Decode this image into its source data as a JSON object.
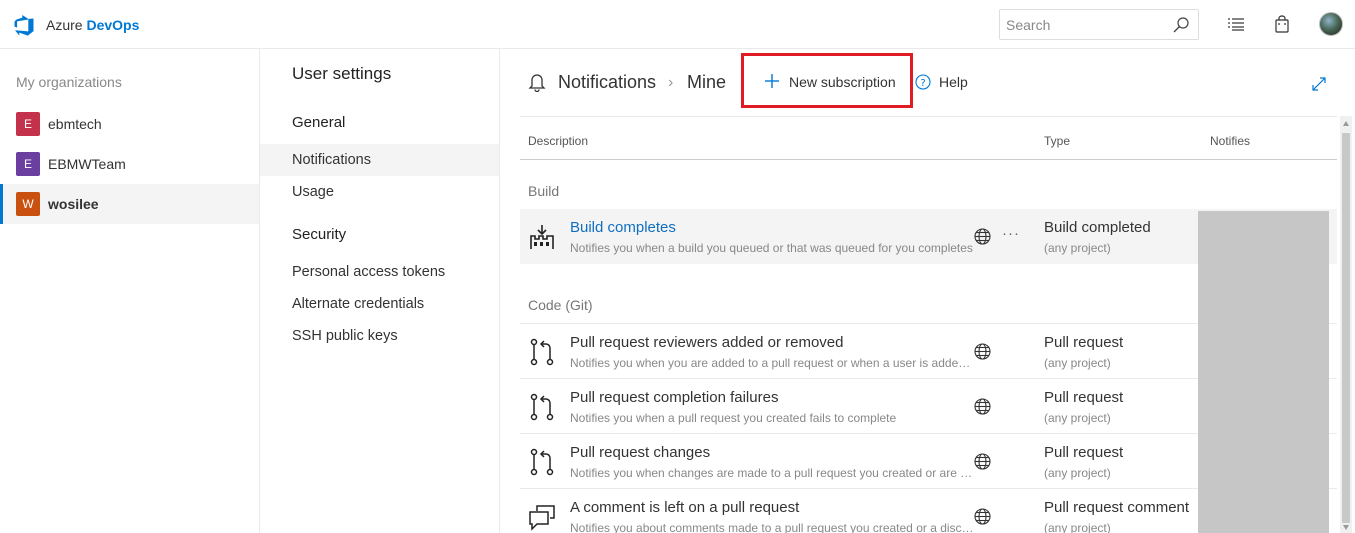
{
  "header": {
    "brand_prefix": "Azure",
    "brand_name": "DevOps",
    "search_placeholder": "Search"
  },
  "orgs": {
    "title": "My organizations",
    "items": [
      {
        "initial": "E",
        "name": "ebmtech",
        "color": "#c4314b"
      },
      {
        "initial": "E",
        "name": "EBMWTeam",
        "color": "#6b3fa0"
      },
      {
        "initial": "W",
        "name": "wosilee",
        "color": "#ca5010"
      }
    ]
  },
  "settings": {
    "title": "User settings",
    "general_header": "General",
    "security_header": "Security",
    "general_items": [
      "Notifications",
      "Usage"
    ],
    "security_items": [
      "Personal access tokens",
      "Alternate credentials",
      "SSH public keys"
    ]
  },
  "main": {
    "breadcrumb": [
      "Notifications",
      "Mine"
    ],
    "breadcrumb_sep": "›",
    "new_subscription": "New subscription",
    "help": "Help",
    "columns": [
      "Description",
      "Type",
      "Notifies"
    ],
    "groups": [
      "Build",
      "Code (Git)"
    ],
    "rows": [
      {
        "icon": "build-icon",
        "title": "Build completes",
        "desc": "Notifies you when a build you queued or that was queued for you completes",
        "type": "Build completed",
        "scope": "(any project)"
      },
      {
        "icon": "pull-request-icon",
        "title": "Pull request reviewers added or removed",
        "desc": "Notifies you when you are added to a pull request or when a user is added or removed",
        "type": "Pull request",
        "scope": "(any project)"
      },
      {
        "icon": "pull-request-icon",
        "title": "Pull request completion failures",
        "desc": "Notifies you when a pull request you created fails to complete",
        "type": "Pull request",
        "scope": "(any project)"
      },
      {
        "icon": "pull-request-icon",
        "title": "Pull request changes",
        "desc": "Notifies you when changes are made to a pull request you created or are a reviewer on",
        "type": "Pull request",
        "scope": "(any project)"
      },
      {
        "icon": "comment-icon",
        "title": "A comment is left on a pull request",
        "desc": "Notifies you about comments made to a pull request you created or a discussion you are in",
        "type": "Pull request comment",
        "scope": "(any project)"
      }
    ],
    "more": "···"
  },
  "colors": {
    "accent": "#0078d4",
    "highlight_border": "#e01b24",
    "redaction": "#c6c6c6"
  }
}
